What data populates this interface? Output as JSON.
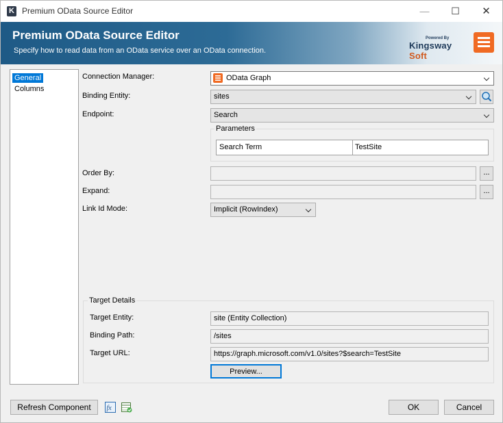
{
  "window": {
    "title": "Premium OData Source Editor",
    "app_icon_letter": "K",
    "minimize_glyph": "—",
    "maximize_glyph": "☐",
    "close_glyph": "✕"
  },
  "banner": {
    "title": "Premium OData Source Editor",
    "subtitle": "Specify how to read data from an OData service over an OData connection.",
    "brand_pre": "Powered By",
    "brand_main": "Kingsway",
    "brand_suffix": "Soft"
  },
  "nav": {
    "items": [
      {
        "label": "General",
        "selected": true
      },
      {
        "label": "Columns",
        "selected": false
      }
    ]
  },
  "form": {
    "connection_manager": {
      "label": "Connection Manager:",
      "value": "OData Graph"
    },
    "binding_entity": {
      "label": "Binding Entity:",
      "value": "sites"
    },
    "endpoint": {
      "label": "Endpoint:",
      "value": "Search"
    },
    "parameters": {
      "title": "Parameters",
      "rows": [
        {
          "name": "Search Term",
          "value": "TestSite"
        }
      ]
    },
    "order_by": {
      "label": "Order By:",
      "value": "",
      "button": "..."
    },
    "expand": {
      "label": "Expand:",
      "value": "",
      "button": "..."
    },
    "link_id_mode": {
      "label": "Link Id Mode:",
      "value": "Implicit (RowIndex)"
    }
  },
  "target_details": {
    "title": "Target Details",
    "target_entity": {
      "label": "Target Entity:",
      "value": "site (Entity Collection)"
    },
    "binding_path": {
      "label": "Binding Path:",
      "value": "/sites"
    },
    "target_url": {
      "label": "Target URL:",
      "value": "https://graph.microsoft.com/v1.0/sites?$search=TestSite"
    },
    "preview_button": "Preview..."
  },
  "footer": {
    "refresh_button": "Refresh Component",
    "ok_button": "OK",
    "cancel_button": "Cancel"
  },
  "colors": {
    "accent": "#0078d7",
    "brand_orange": "#f06a23",
    "banner_dark": "#1e5a86"
  }
}
